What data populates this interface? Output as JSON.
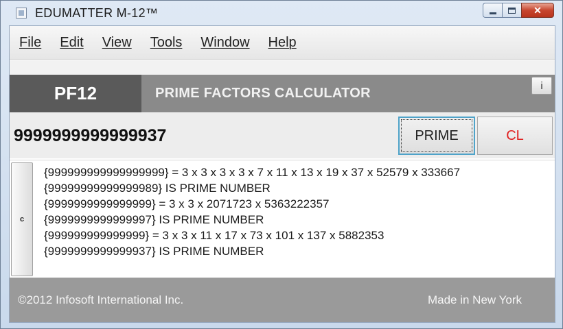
{
  "window": {
    "title": "EDUMATTER M-12™",
    "caption": {
      "close_label": "✕"
    }
  },
  "menubar": {
    "items": [
      "File",
      "Edit",
      "View",
      "Tools",
      "Window",
      "Help"
    ]
  },
  "header": {
    "code": "PF12",
    "title": "PRIME FACTORS CALCULATOR",
    "info_label": "i"
  },
  "input": {
    "value": "9999999999999937"
  },
  "buttons": {
    "prime_label": "PRIME",
    "clear_label": "CL",
    "c_label": "c"
  },
  "results": [
    "{999999999999999999} = 3 x 3 x 3 x 3 x 7 x 11 x 13 x 19 x 37 x 52579 x 333667",
    "{99999999999999989} IS PRIME NUMBER",
    "{9999999999999999} = 3 x 3 x 2071723 x 5363222357",
    "{9999999999999997} IS PRIME NUMBER",
    "{999999999999999} = 3 x 3 x 11 x 17 x 73 x 101 x 137 x 5882353",
    "{9999999999999937} IS PRIME NUMBER"
  ],
  "footer": {
    "copyright": "©2012 Infosoft International Inc.",
    "made_in": "Made in New York"
  }
}
